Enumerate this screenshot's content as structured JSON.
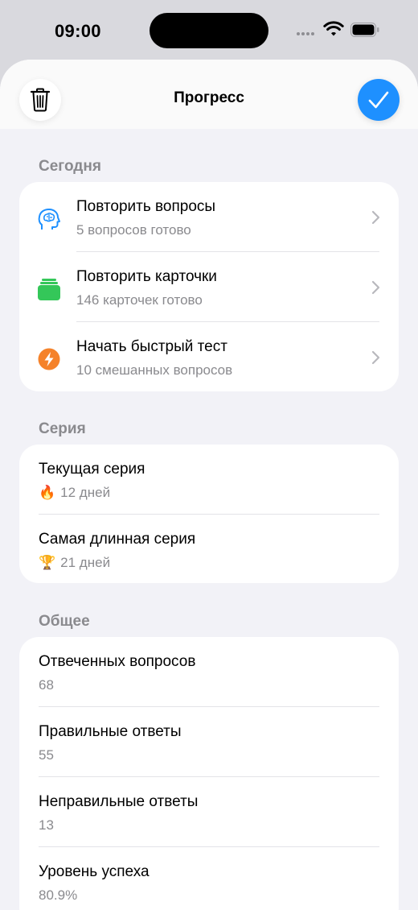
{
  "status": {
    "time": "09:00"
  },
  "nav": {
    "title": "Прогресс"
  },
  "today": {
    "header": "Сегодня",
    "items": [
      {
        "title": "Повторить вопросы",
        "subtitle": "5 вопросов готово",
        "icon": "brain-icon",
        "color": "#1e90ff"
      },
      {
        "title": "Повторить карточки",
        "subtitle": "146 карточек готово",
        "icon": "cards-icon",
        "color": "#34c759"
      },
      {
        "title": "Начать быстрый тест",
        "subtitle": "10 смешанных вопросов",
        "icon": "bolt-icon",
        "color": "#f5822a"
      }
    ]
  },
  "streak": {
    "header": "Серия",
    "current": {
      "title": "Текущая серия",
      "emoji": "🔥",
      "value": "12 дней"
    },
    "longest": {
      "title": "Самая длинная серия",
      "emoji": "🏆",
      "value": "21 дней"
    }
  },
  "general": {
    "header": "Общее",
    "items": [
      {
        "title": "Отвеченных вопросов",
        "value": "68"
      },
      {
        "title": "Правильные ответы",
        "value": "55"
      },
      {
        "title": "Неправильные ответы",
        "value": "13"
      },
      {
        "title": "Уровень успеха",
        "value": "80.9%"
      }
    ]
  },
  "colors": {
    "accent": "#1e90ff",
    "background": "#f2f2f7",
    "secondary_text": "#8a8a8e"
  }
}
